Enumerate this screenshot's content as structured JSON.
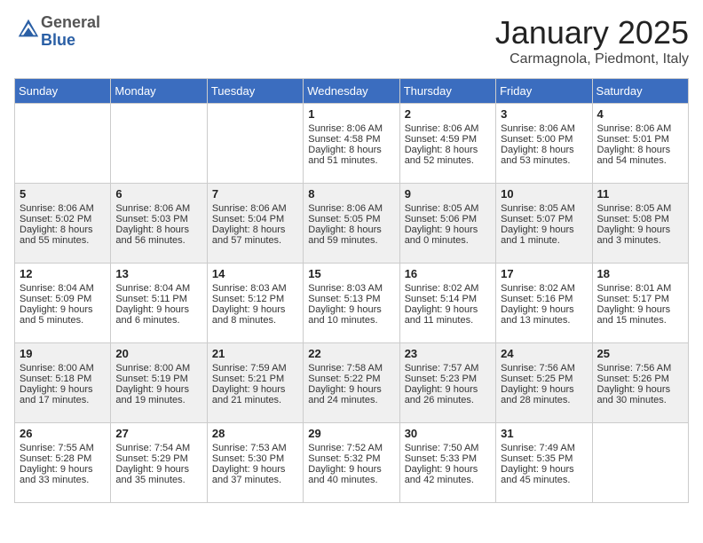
{
  "header": {
    "logo_general": "General",
    "logo_blue": "Blue",
    "month_title": "January 2025",
    "location": "Carmagnola, Piedmont, Italy"
  },
  "weekdays": [
    "Sunday",
    "Monday",
    "Tuesday",
    "Wednesday",
    "Thursday",
    "Friday",
    "Saturday"
  ],
  "weeks": [
    [
      {
        "day": "",
        "info": ""
      },
      {
        "day": "",
        "info": ""
      },
      {
        "day": "",
        "info": ""
      },
      {
        "day": "1",
        "info": "Sunrise: 8:06 AM\nSunset: 4:58 PM\nDaylight: 8 hours and 51 minutes."
      },
      {
        "day": "2",
        "info": "Sunrise: 8:06 AM\nSunset: 4:59 PM\nDaylight: 8 hours and 52 minutes."
      },
      {
        "day": "3",
        "info": "Sunrise: 8:06 AM\nSunset: 5:00 PM\nDaylight: 8 hours and 53 minutes."
      },
      {
        "day": "4",
        "info": "Sunrise: 8:06 AM\nSunset: 5:01 PM\nDaylight: 8 hours and 54 minutes."
      }
    ],
    [
      {
        "day": "5",
        "info": "Sunrise: 8:06 AM\nSunset: 5:02 PM\nDaylight: 8 hours and 55 minutes."
      },
      {
        "day": "6",
        "info": "Sunrise: 8:06 AM\nSunset: 5:03 PM\nDaylight: 8 hours and 56 minutes."
      },
      {
        "day": "7",
        "info": "Sunrise: 8:06 AM\nSunset: 5:04 PM\nDaylight: 8 hours and 57 minutes."
      },
      {
        "day": "8",
        "info": "Sunrise: 8:06 AM\nSunset: 5:05 PM\nDaylight: 8 hours and 59 minutes."
      },
      {
        "day": "9",
        "info": "Sunrise: 8:05 AM\nSunset: 5:06 PM\nDaylight: 9 hours and 0 minutes."
      },
      {
        "day": "10",
        "info": "Sunrise: 8:05 AM\nSunset: 5:07 PM\nDaylight: 9 hours and 1 minute."
      },
      {
        "day": "11",
        "info": "Sunrise: 8:05 AM\nSunset: 5:08 PM\nDaylight: 9 hours and 3 minutes."
      }
    ],
    [
      {
        "day": "12",
        "info": "Sunrise: 8:04 AM\nSunset: 5:09 PM\nDaylight: 9 hours and 5 minutes."
      },
      {
        "day": "13",
        "info": "Sunrise: 8:04 AM\nSunset: 5:11 PM\nDaylight: 9 hours and 6 minutes."
      },
      {
        "day": "14",
        "info": "Sunrise: 8:03 AM\nSunset: 5:12 PM\nDaylight: 9 hours and 8 minutes."
      },
      {
        "day": "15",
        "info": "Sunrise: 8:03 AM\nSunset: 5:13 PM\nDaylight: 9 hours and 10 minutes."
      },
      {
        "day": "16",
        "info": "Sunrise: 8:02 AM\nSunset: 5:14 PM\nDaylight: 9 hours and 11 minutes."
      },
      {
        "day": "17",
        "info": "Sunrise: 8:02 AM\nSunset: 5:16 PM\nDaylight: 9 hours and 13 minutes."
      },
      {
        "day": "18",
        "info": "Sunrise: 8:01 AM\nSunset: 5:17 PM\nDaylight: 9 hours and 15 minutes."
      }
    ],
    [
      {
        "day": "19",
        "info": "Sunrise: 8:00 AM\nSunset: 5:18 PM\nDaylight: 9 hours and 17 minutes."
      },
      {
        "day": "20",
        "info": "Sunrise: 8:00 AM\nSunset: 5:19 PM\nDaylight: 9 hours and 19 minutes."
      },
      {
        "day": "21",
        "info": "Sunrise: 7:59 AM\nSunset: 5:21 PM\nDaylight: 9 hours and 21 minutes."
      },
      {
        "day": "22",
        "info": "Sunrise: 7:58 AM\nSunset: 5:22 PM\nDaylight: 9 hours and 24 minutes."
      },
      {
        "day": "23",
        "info": "Sunrise: 7:57 AM\nSunset: 5:23 PM\nDaylight: 9 hours and 26 minutes."
      },
      {
        "day": "24",
        "info": "Sunrise: 7:56 AM\nSunset: 5:25 PM\nDaylight: 9 hours and 28 minutes."
      },
      {
        "day": "25",
        "info": "Sunrise: 7:56 AM\nSunset: 5:26 PM\nDaylight: 9 hours and 30 minutes."
      }
    ],
    [
      {
        "day": "26",
        "info": "Sunrise: 7:55 AM\nSunset: 5:28 PM\nDaylight: 9 hours and 33 minutes."
      },
      {
        "day": "27",
        "info": "Sunrise: 7:54 AM\nSunset: 5:29 PM\nDaylight: 9 hours and 35 minutes."
      },
      {
        "day": "28",
        "info": "Sunrise: 7:53 AM\nSunset: 5:30 PM\nDaylight: 9 hours and 37 minutes."
      },
      {
        "day": "29",
        "info": "Sunrise: 7:52 AM\nSunset: 5:32 PM\nDaylight: 9 hours and 40 minutes."
      },
      {
        "day": "30",
        "info": "Sunrise: 7:50 AM\nSunset: 5:33 PM\nDaylight: 9 hours and 42 minutes."
      },
      {
        "day": "31",
        "info": "Sunrise: 7:49 AM\nSunset: 5:35 PM\nDaylight: 9 hours and 45 minutes."
      },
      {
        "day": "",
        "info": ""
      }
    ]
  ]
}
